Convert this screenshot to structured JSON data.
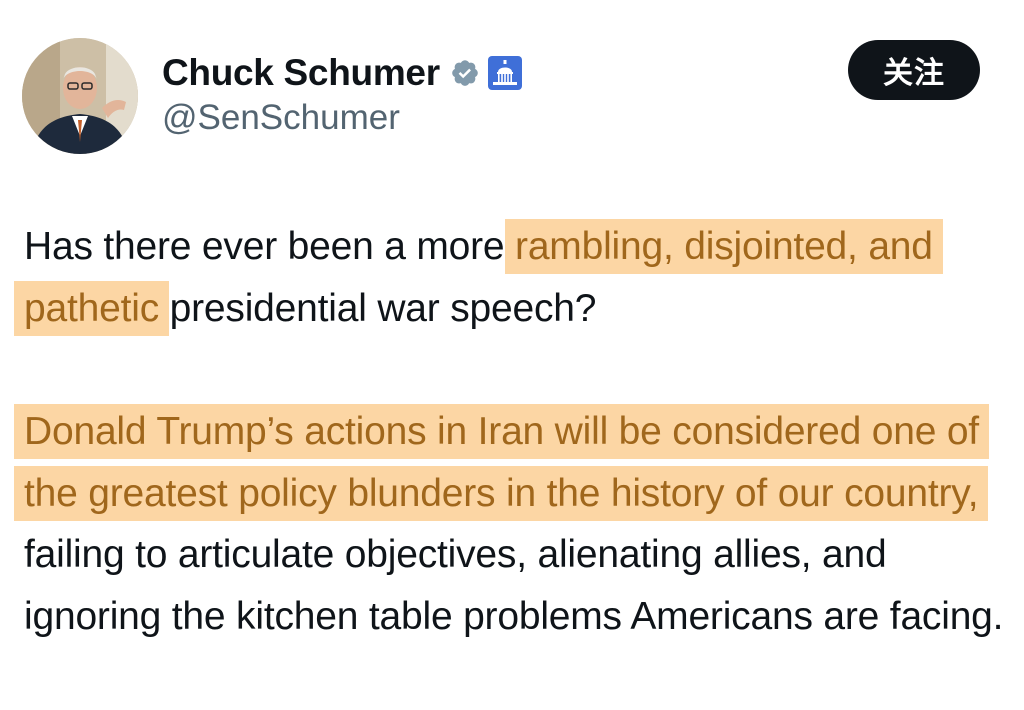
{
  "profile": {
    "display_name": "Chuck Schumer",
    "handle": "@SenSchumer",
    "verified_icon": "verified-badge-icon",
    "affiliation_icon": "capitol-building-icon",
    "follow_label": "关注"
  },
  "tweet": {
    "paragraphs": [
      {
        "segments": [
          {
            "text": "Has there ever been a more ",
            "highlight": false
          },
          {
            "text": "rambling, disjointed, and pathetic",
            "highlight": true
          },
          {
            "text": " presidential war speech?",
            "highlight": false
          }
        ]
      },
      {
        "segments": [
          {
            "text": "Donald Trump’s actions in Iran will be considered one of the greatest policy blunders in the history of our country,",
            "highlight": true
          },
          {
            "text": " failing to articulate objectives, alienating allies, and ignoring the kitchen table problems Americans are facing.",
            "highlight": false
          }
        ]
      }
    ]
  },
  "colors": {
    "highlight_background": "#fcd6a4",
    "highlight_text": "#a0671c",
    "text_primary": "#0f1419",
    "text_secondary": "#536471",
    "verified_badge": "#829aab",
    "button_background": "#0f1419"
  }
}
